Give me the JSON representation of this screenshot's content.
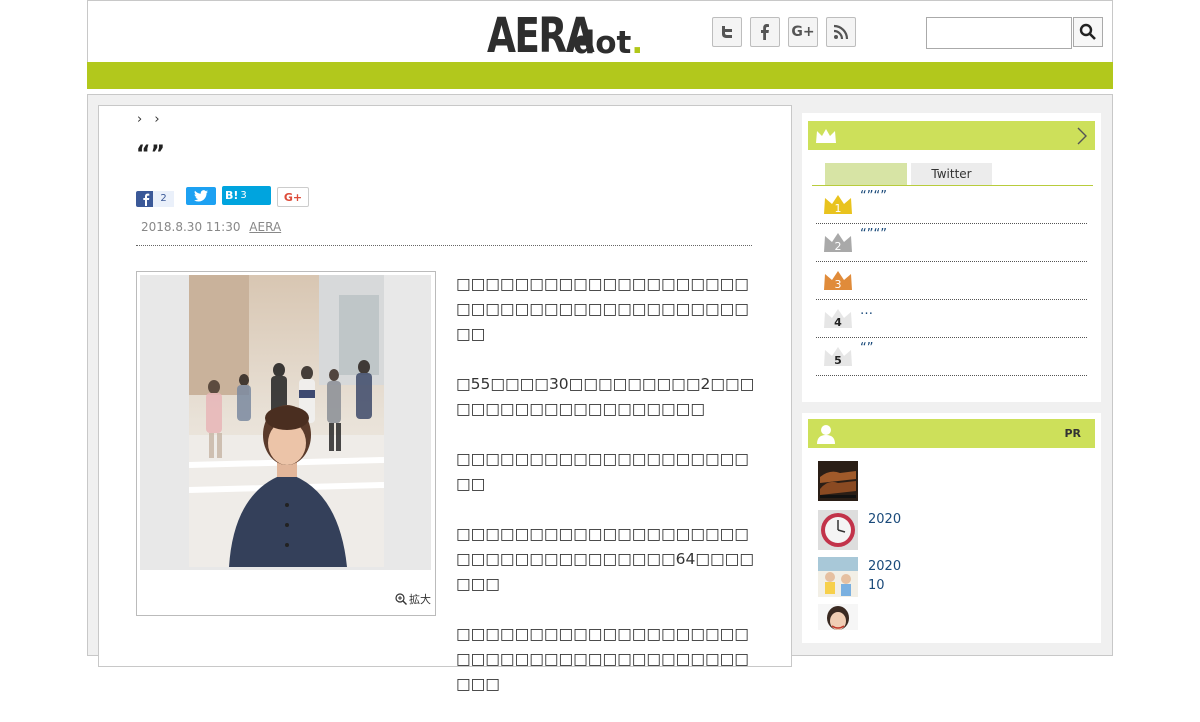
{
  "header": {
    "logo_main": "AERA",
    "logo_sub": "dot",
    "logo_dot": ".",
    "social_icons": [
      "twitter-icon",
      "facebook-icon",
      "google-plus-icon",
      "rss-icon"
    ],
    "search_placeholder": ""
  },
  "breadcrumb": {
    "sep1": "›",
    "sep2": "›"
  },
  "article": {
    "title": "“”",
    "share": {
      "facebook_count": "2",
      "hatena_label": "B!",
      "hatena_count": "3"
    },
    "date": "2018.8.30 11:30",
    "source": "AERA",
    "zoom_label": "拡大",
    "paragraphs": [
      "□□□□□□□□□□□□□□□□□□□□□□□□□□□□□□□□□□□□□□□□□□",
      "□55□□□□30□□□□□□□□□2□□□□□□□□□□□□□□□□□□□□",
      "□□□□□□□□□□□□□□□□□□□□□□",
      "□□□□□□□□□□□□□□□□□□□□□□□□□□□□□□□□□□□64□□□□□□□",
      "□□□□□□□□□□□□□□□□□□□□□□□□□□□□□□□□□□□□□□□□□□□"
    ]
  },
  "ranking": {
    "tabs": [
      "",
      "Twitter"
    ],
    "items": [
      {
        "rank": "1",
        "text": "“”“”"
      },
      {
        "rank": "2",
        "text": "“”“”"
      },
      {
        "rank": "3",
        "text": ""
      },
      {
        "rank": "4",
        "text": "…"
      },
      {
        "rank": "5",
        "text": "“”"
      }
    ],
    "colors": {
      "gold": "#e9c31e",
      "silver": "#a9a9a9",
      "bronze": "#e08b3a",
      "plain": "#e6e6e6"
    }
  },
  "pr": {
    "label": "PR",
    "items": [
      {
        "line1": "",
        "line2": ""
      },
      {
        "line1": "2020",
        "line2": ""
      },
      {
        "line1": "2020",
        "line2": "10"
      },
      {
        "line1": "",
        "line2": ""
      }
    ]
  },
  "colors": {
    "accent": "#b2c81c",
    "header_green": "#cde05a"
  }
}
